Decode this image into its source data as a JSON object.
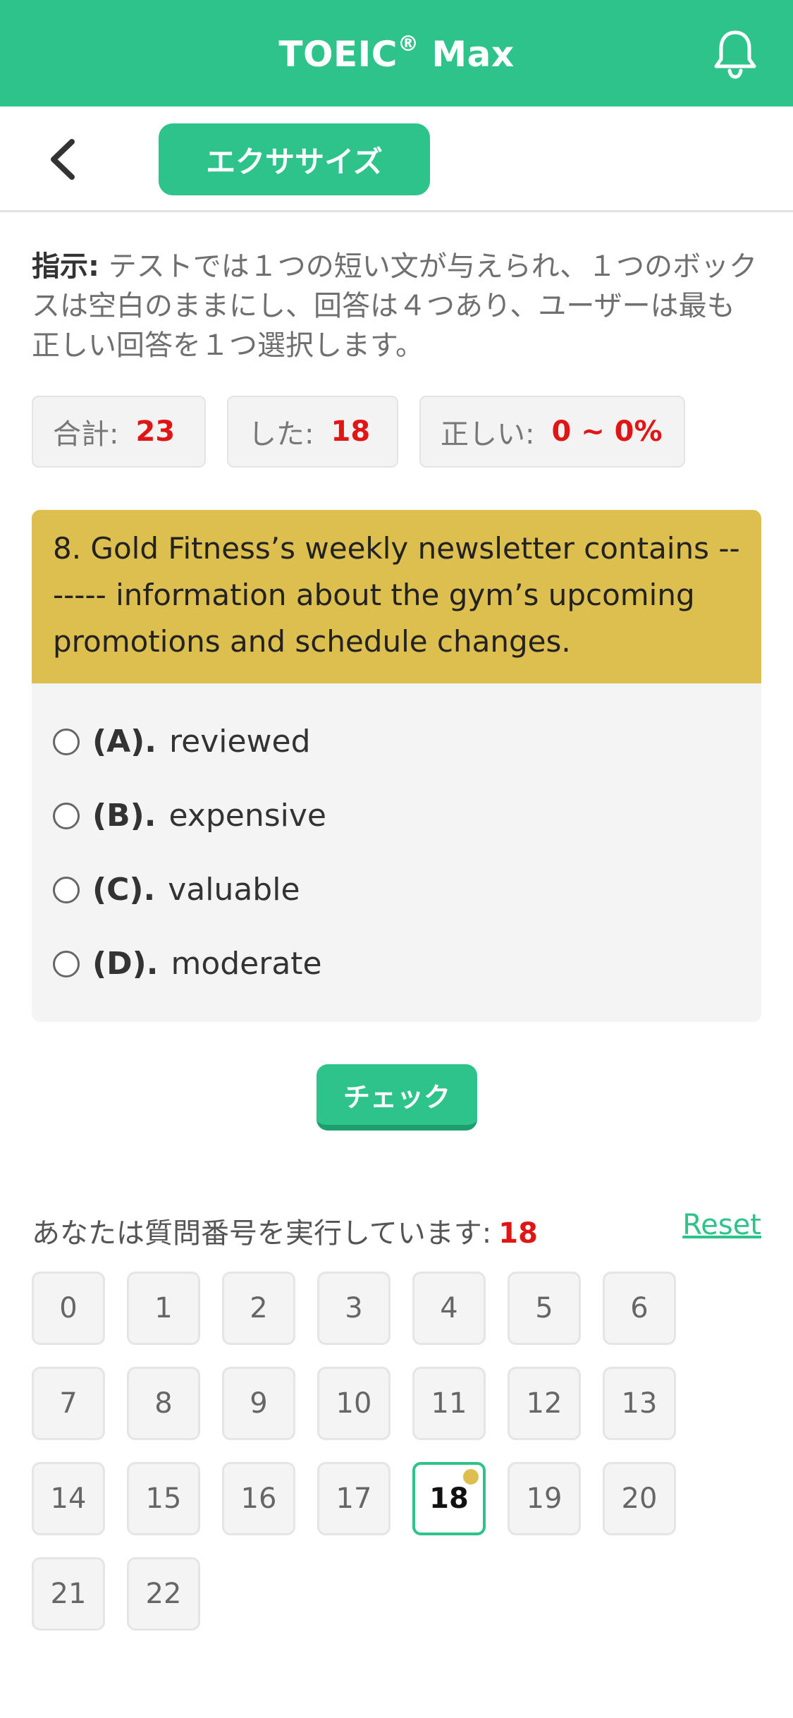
{
  "header": {
    "app_title": "TOEIC",
    "app_title_mark": "®",
    "app_title_suffix": "Max",
    "icon": "bell-icon",
    "accent_color": "#2ec38a"
  },
  "subbar": {
    "back_icon": "chevron-left-icon",
    "tab_label": "エクササイズ"
  },
  "instruction": {
    "label": "指示:",
    "text": " テストでは１つの短い文が与えられ、１つのボックスは空白のままにし、回答は４つあり、ユーザーは最も正しい回答を１つ選択します。"
  },
  "stats": {
    "total_label": "合計:",
    "total_value": "23",
    "done_label": "した:",
    "done_value": "18",
    "correct_label": "正しい:",
    "correct_value": "0 ~ 0%"
  },
  "question": {
    "text": "8. Gold Fitness’s weekly newsletter contains ------- information about the gym’s upcoming promotions and schedule changes.",
    "options": [
      {
        "letter": "(A).",
        "text": "reviewed"
      },
      {
        "letter": "(B).",
        "text": "expensive"
      },
      {
        "letter": "(C).",
        "text": "valuable"
      },
      {
        "letter": "(D).",
        "text": "moderate"
      }
    ]
  },
  "check_button": "チェック",
  "progress": {
    "label": "あなたは質問番号を実行しています:",
    "current": "18",
    "reset_label": "Reset"
  },
  "question_numbers": [
    "0",
    "1",
    "2",
    "3",
    "4",
    "5",
    "6",
    "7",
    "8",
    "9",
    "10",
    "11",
    "12",
    "13",
    "14",
    "15",
    "16",
    "17",
    "18",
    "19",
    "20",
    "21",
    "22"
  ],
  "current_index": 18,
  "colors": {
    "accent": "#2ec38a",
    "question_header": "#dcbf4e",
    "highlight_number": "#e01616"
  }
}
